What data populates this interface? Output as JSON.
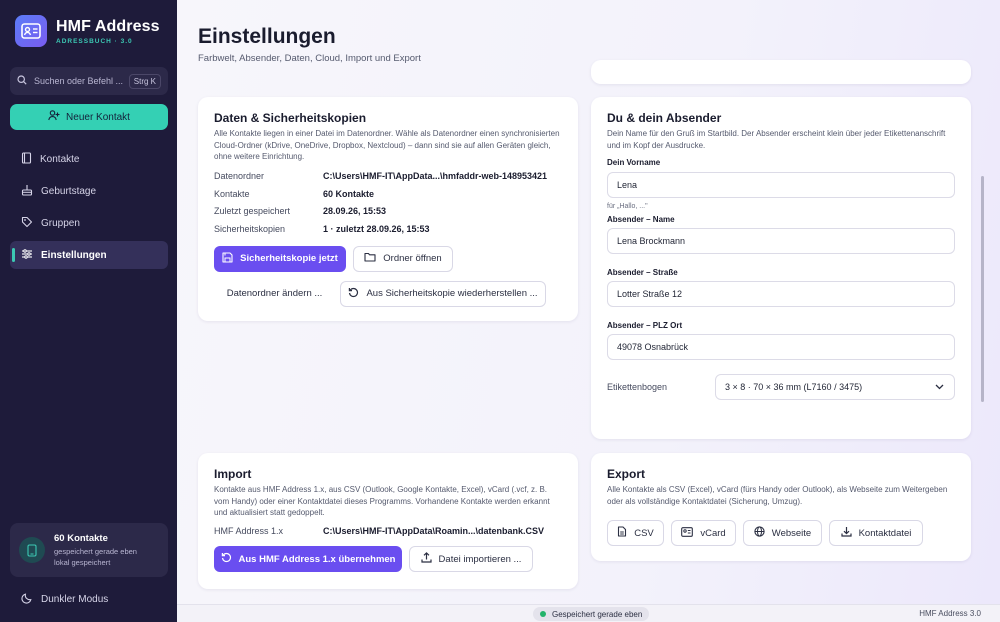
{
  "app": {
    "title": "HMF Address",
    "subtitle": "ADRESSBUCH · 3.0"
  },
  "sidebar": {
    "search_placeholder": "Suchen oder Befehl ...",
    "search_shortcut": "Strg K",
    "new_contact": "Neuer Kontakt",
    "nav": {
      "contacts": "Kontakte",
      "birthdays": "Geburtstage",
      "groups": "Gruppen",
      "settings": "Einstellungen"
    },
    "stat": {
      "title": "60 Kontakte",
      "line1": "gespeichert gerade eben",
      "line2": "lokal gespeichert"
    },
    "dark_mode": "Dunkler Modus"
  },
  "page": {
    "title": "Einstellungen",
    "subtitle": "Farbwelt, Absender, Daten, Cloud, Import und Export"
  },
  "data_card": {
    "title": "Daten & Sicherheitskopien",
    "desc": "Alle Kontakte liegen in einer Datei im Datenordner. Wähle als Datenordner einen synchronisierten Cloud-Ordner (kDrive, OneDrive, Dropbox, Nextcloud) – dann sind sie auf allen Geräten gleich, ohne weitere Einrichtung.",
    "rows": [
      {
        "k": "Datenordner",
        "v": "C:\\Users\\HMF-IT\\AppData...\\hmfaddr-web-148953421"
      },
      {
        "k": "Kontakte",
        "v": "60 Kontakte"
      },
      {
        "k": "Zuletzt gespeichert",
        "v": "28.09.26, 15:53"
      },
      {
        "k": "Sicherheitskopien",
        "v": "1 · zuletzt 28.09.26, 15:53"
      }
    ],
    "backup_now": "Sicherheitskopie jetzt",
    "open_folder": "Ordner öffnen",
    "change_folder": "Datenordner ändern ...",
    "restore": "Aus Sicherheitskopie wiederherstellen ..."
  },
  "sender_card": {
    "title": "Du & dein Absender",
    "desc": "Dein Name für den Gruß im Startbild. Der Absender erscheint klein über jeder Etikettenanschrift und im Kopf der Ausdrucke.",
    "first_name_label": "Dein Vorname",
    "first_name": "Lena",
    "first_name_hint": "für „Hallo, ...\"",
    "sender_name_label": "Absender – Name",
    "sender_name": "Lena Brockmann",
    "sender_street_label": "Absender – Straße",
    "sender_street": "Lotter Straße 12",
    "sender_city_label": "Absender – PLZ Ort",
    "sender_city": "49078 Osnabrück",
    "label_sheet_label": "Etikettenbogen",
    "label_sheet": "3 × 8 · 70 × 36 mm (L7160 / 3475)"
  },
  "import_card": {
    "title": "Import",
    "desc": "Kontakte aus HMF Address 1.x, aus CSV (Outlook, Google Kontakte, Excel), vCard (.vcf, z. B. vom Handy) oder einer Kontaktdatei dieses Programms. Vorhandene Kontakte werden erkannt und aktualisiert statt gedoppelt.",
    "row_k": "HMF Address 1.x",
    "row_v": "C:\\Users\\HMF-IT\\AppData\\Roamin...\\datenbank.CSV",
    "take_over": "Aus HMF Address 1.x übernehmen",
    "import_file": "Datei importieren ..."
  },
  "export_card": {
    "title": "Export",
    "desc": "Alle Kontakte als CSV (Excel), vCard (fürs Handy oder Outlook), als Webseite zum Weitergeben oder als vollständige Kontaktdatei (Sicherung, Umzug).",
    "csv": "CSV",
    "vcard": "vCard",
    "website": "Webseite",
    "contact_file": "Kontaktdatei"
  },
  "statusbar": {
    "saved": "Gespeichert gerade eben",
    "version": "HMF Address 3.0"
  },
  "colors": {
    "sidebar": "#1e1b3a",
    "accent": "#6a4ef0",
    "teal": "#34d0b4",
    "status_ok": "#23b36b"
  }
}
